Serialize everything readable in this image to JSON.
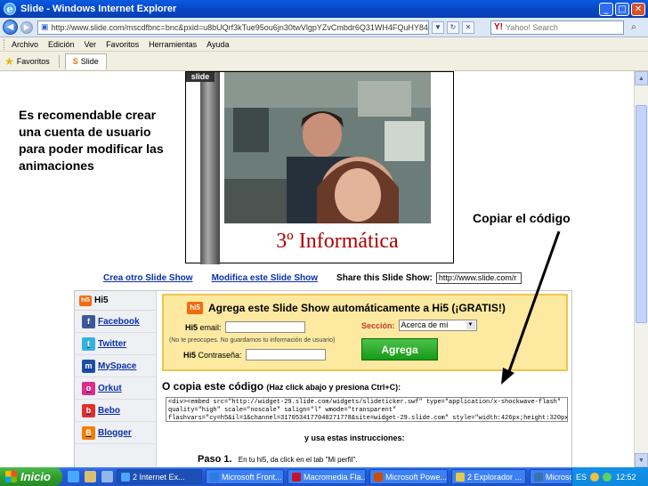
{
  "window": {
    "title": "Slide - Windows Internet Explorer",
    "ie_glyph": "e",
    "minimize_glyph": "_",
    "maximize_glyph": "□",
    "close_glyph": "✕"
  },
  "addressbar": {
    "back_glyph": "◀",
    "forward_glyph": "▶",
    "page_glyph": "▣",
    "url": "http://www.slide.com/mscdfbnc=bnc&pxid=u8bUQrf3kTue95ou6jn30twVlgpYZvCmbdr6Q31WH4FQuHY84bx...",
    "dropdown_glyph": "▼",
    "refresh_glyph": "↻",
    "stop_glyph": "✕",
    "search_logo": "Y!",
    "search_placeholder": "Yahoo! Search",
    "search_glyph": "⌕"
  },
  "menubar": {
    "items": [
      "Archivo",
      "Edición",
      "Ver",
      "Favoritos",
      "Herramientas",
      "Ayuda"
    ]
  },
  "favorites": {
    "star_glyph": "★",
    "label": "Favoritos",
    "tab_logo": "S",
    "tab_label": "Slide"
  },
  "scrollbar": {
    "up_glyph": "▲",
    "down_glyph": "▼"
  },
  "annotations": {
    "left": "Es recomendable crear una cuenta de usuario para poder modificar las animaciones",
    "right": "Copiar el código"
  },
  "slideshow": {
    "tag": "slide",
    "caption": "3º Informática",
    "link_create": "Crea otro Slide Show",
    "link_modify": "Modifica este Slide Show",
    "share_label": "Share this Slide Show:",
    "share_url": "http://www.slide.com/r"
  },
  "widget": {
    "sidebar_header": "Hi5",
    "hi5_badge": "hi5",
    "sidebar_items": [
      {
        "label": "Facebook",
        "glyph": "f",
        "color": "#3b5998"
      },
      {
        "label": "Twitter",
        "glyph": "t",
        "color": "#33b1e0"
      },
      {
        "label": "MySpace",
        "glyph": "m",
        "color": "#1c4fa0"
      },
      {
        "label": "Orkut",
        "glyph": "o",
        "color": "#d8308a"
      },
      {
        "label": "Bebo",
        "glyph": "b",
        "color": "#e0302a"
      },
      {
        "label": "Blogger",
        "glyph": "B",
        "color": "#f57d00"
      }
    ],
    "promo_title": "Agrega este Slide Show automáticamente a Hi5 (¡GRATIS!)",
    "email_label_brand": "Hi5",
    "email_label": "email:",
    "note": "(No te preocupes. No guardamos tu información de usuario)",
    "password_label_brand": "Hi5",
    "password_label": "Contraseña:",
    "section_label": "Sección:",
    "section_value": "Acerca de mí",
    "caret_glyph": "▼",
    "add_button": "Agrega",
    "code_title": "O copia este código",
    "code_hint": "(Haz click abajo y presiona Ctrl+C):",
    "code_line1": "<div><embed src=\"http://widget-29.slide.com/widgets/slideticker.swf\" type=\"application/x-shockwave-flash\"",
    "code_line2": "quality=\"high\" scale=\"noscale\" salign=\"l\" wmode=\"transparent\"",
    "code_line3": "flashvars=\"cy=h5&il=1&channel=3170534177040271778&site=widget-29.slide.com\" style=\"width:426px;height:320px\"",
    "instructions_head": "y usa estas instrucciones:",
    "step_label": "Paso 1.",
    "step_text": "En tu hi5, da click en el tab \"Mi perfil\"."
  },
  "taskbar": {
    "start": "Inicio",
    "tasks": [
      {
        "label": "2 Internet Ex...",
        "color": "#4aa8ff"
      },
      {
        "label": "Microsoft Front...",
        "color": "#2a7de1"
      },
      {
        "label": "Macromedia Fla...",
        "color": "#c8102e"
      },
      {
        "label": "Microsoft Powe...",
        "color": "#d04a02"
      },
      {
        "label": "2 Explorador ...",
        "color": "#e8c84a"
      },
      {
        "label": "Microsoft Photo...",
        "color": "#3a6fb0"
      }
    ],
    "lang": "ES",
    "clock": "12:52"
  }
}
